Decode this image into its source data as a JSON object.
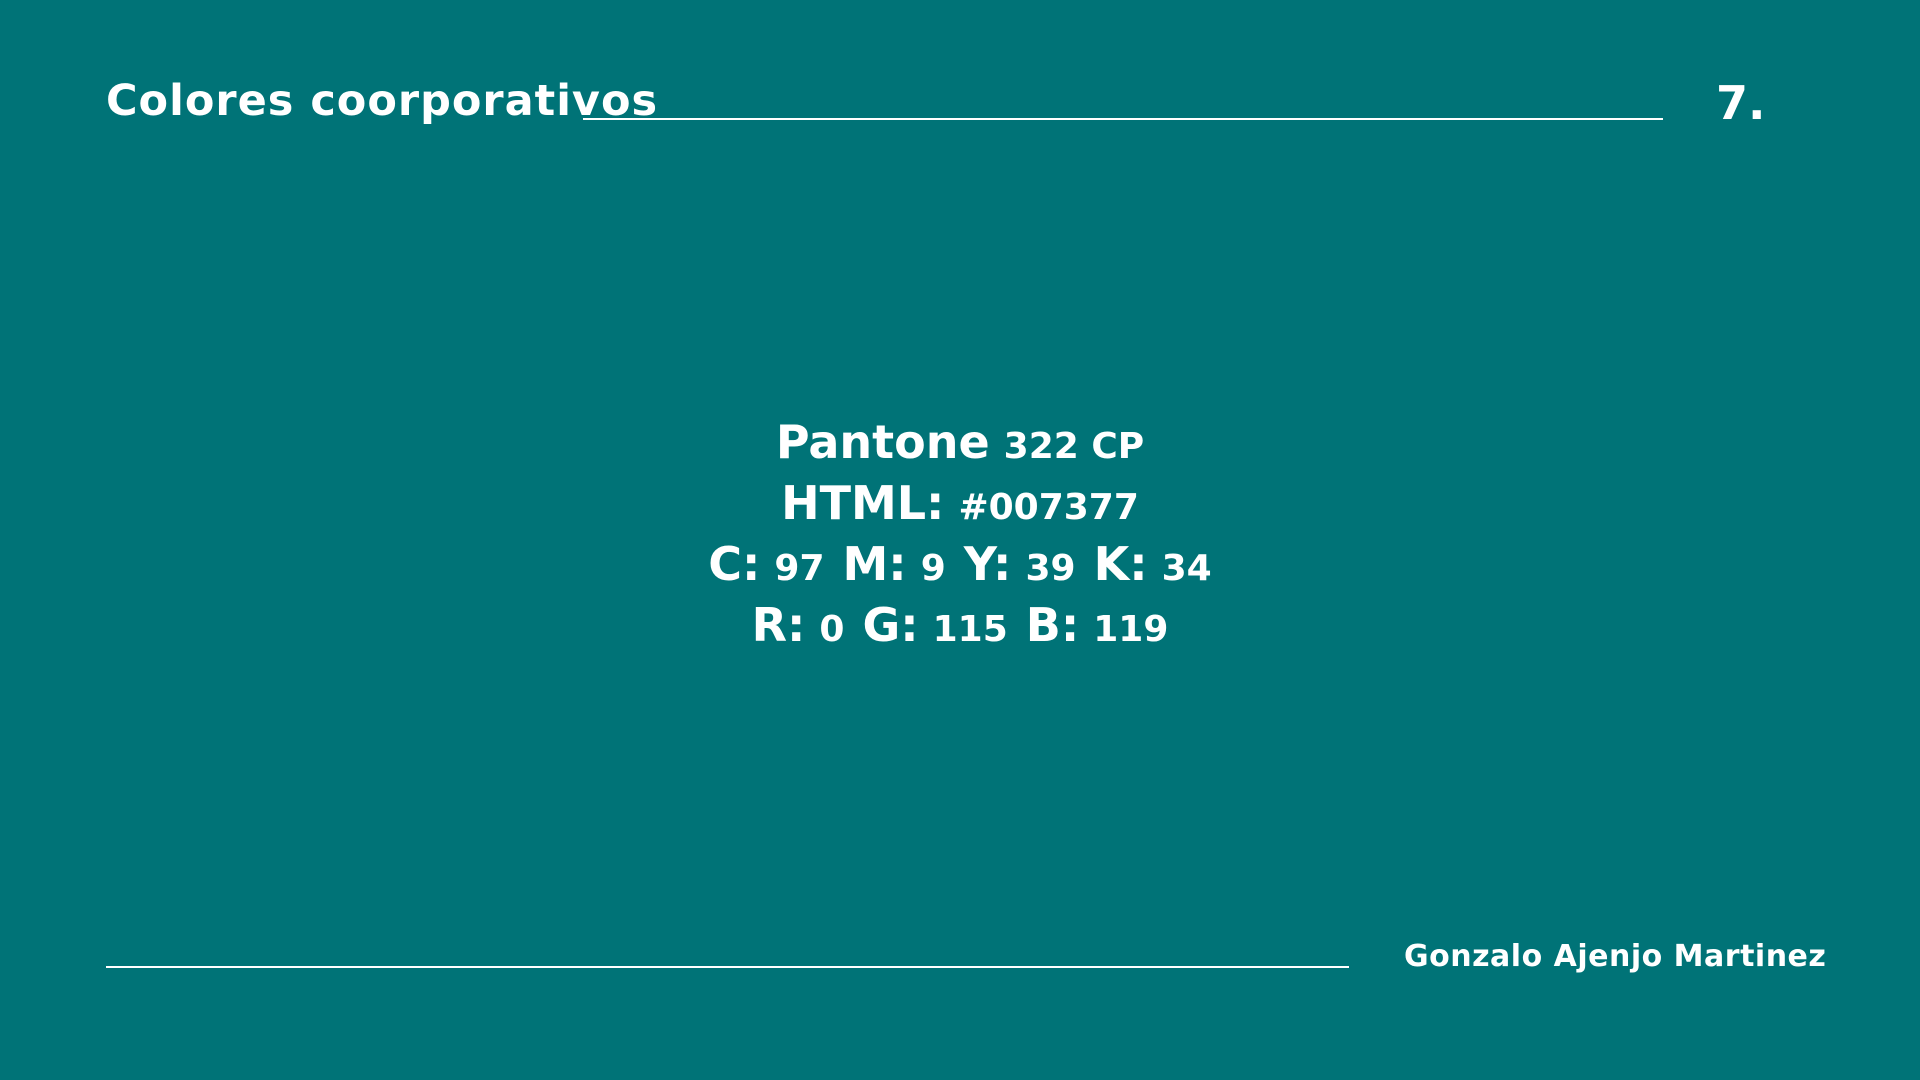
{
  "theme": {
    "background": "#007377",
    "foreground": "#ffffff"
  },
  "header": {
    "title": "Colores coorporativos",
    "page_number": "7."
  },
  "color_spec": {
    "pantone": {
      "label": "Pantone",
      "value": "322 CP"
    },
    "html": {
      "label": "HTML:",
      "value": "#007377"
    },
    "cmyk": [
      {
        "label": "C:",
        "value": "97"
      },
      {
        "label": "M:",
        "value": "9"
      },
      {
        "label": "Y:",
        "value": "39"
      },
      {
        "label": "K:",
        "value": "34"
      }
    ],
    "rgb": [
      {
        "label": "R:",
        "value": "0"
      },
      {
        "label": "G:",
        "value": "115"
      },
      {
        "label": "B:",
        "value": "119"
      }
    ]
  },
  "footer": {
    "author": "Gonzalo Ajenjo Martinez"
  }
}
